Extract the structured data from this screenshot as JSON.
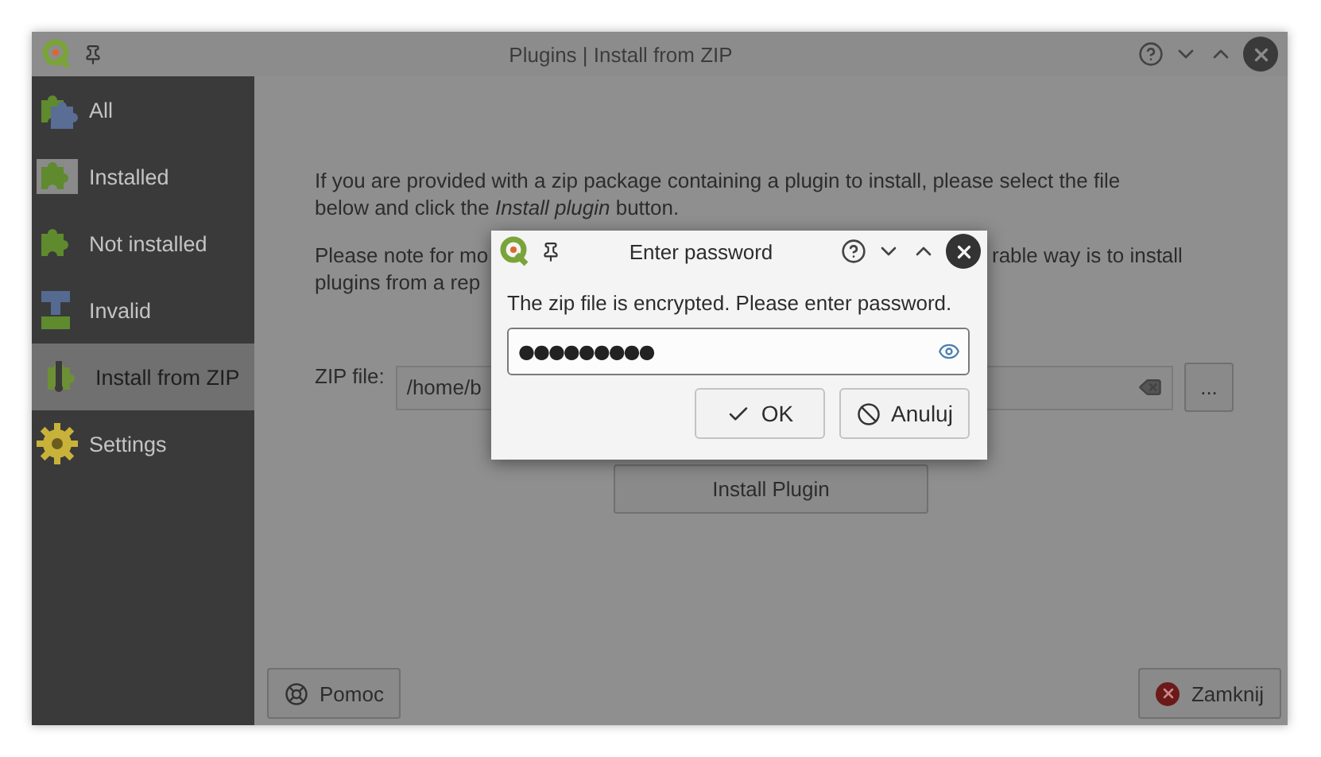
{
  "window": {
    "title": "Plugins | Install from ZIP"
  },
  "sidebar": {
    "items": [
      {
        "label": "All",
        "kind": "all",
        "selected": false
      },
      {
        "label": "Installed",
        "kind": "installed",
        "selected": false
      },
      {
        "label": "Not installed",
        "kind": "not_installed",
        "selected": false
      },
      {
        "label": "Invalid",
        "kind": "invalid",
        "selected": false
      },
      {
        "label": "Install from ZIP",
        "kind": "zip",
        "selected": true
      },
      {
        "label": "Settings",
        "kind": "settings",
        "selected": false
      }
    ]
  },
  "content": {
    "intro": "If you are provided with a zip package containing a plugin to install, please select the file below and click the *Install plugin* button.",
    "note_parts": [
      "Please note for mo",
      "rable way is to install",
      "plugins from a rep"
    ],
    "zip_field": {
      "label": "ZIP file:",
      "value": "/home/b"
    },
    "browse_button": "...",
    "install_button": "Install Plugin"
  },
  "footer": {
    "help_button": "Pomoc",
    "close_button": "Zamknij"
  },
  "dialog": {
    "title": "Enter password",
    "message": "The zip file is encrypted. Please enter password.",
    "password": {
      "value": "●●●●●●●●●"
    },
    "buttons": [
      {
        "label": "OK",
        "kind": "ok"
      },
      {
        "label": "Anuluj",
        "kind": "cancel"
      }
    ]
  }
}
